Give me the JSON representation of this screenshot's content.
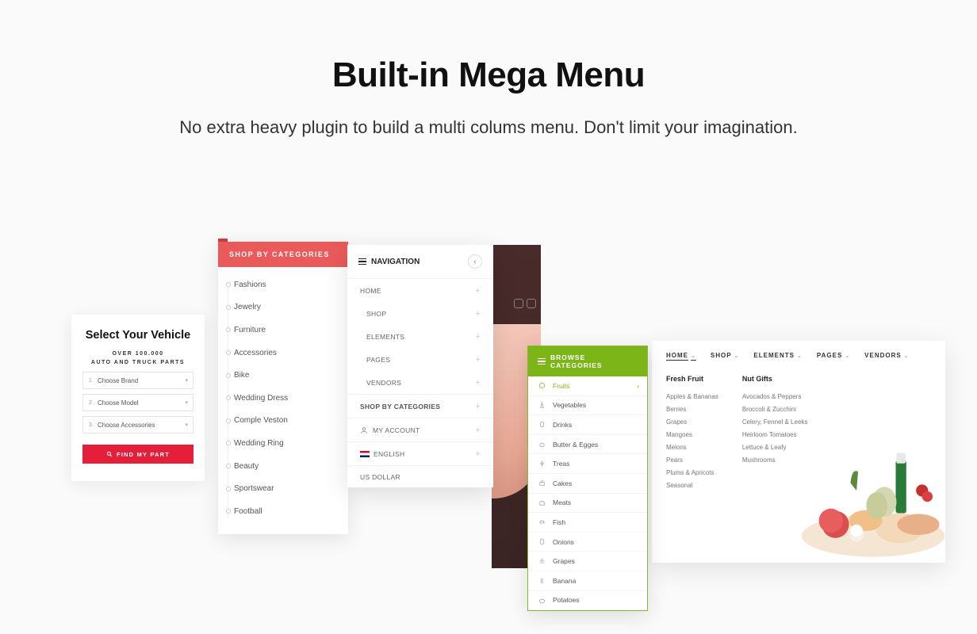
{
  "hero": {
    "title": "Built-in Mega Menu",
    "subtitle": "No extra heavy plugin to build a multi colums menu. Don't limit your imagination."
  },
  "vehicle": {
    "title": "Select Your Vehicle",
    "sub1": "OVER 100.000",
    "sub2": "AUTO AND TRUCK PARTS",
    "steps": [
      {
        "n": "1",
        "label": "Choose Brand"
      },
      {
        "n": "2",
        "label": "Choose Model"
      },
      {
        "n": "3",
        "label": "Choose Accessories"
      }
    ],
    "button": "FIND MY PART"
  },
  "categories": {
    "header": "SHOP BY CATEGORIES",
    "items": [
      "Fashions",
      "Jewelry",
      "Furniture",
      "Accessories",
      "Bike",
      "Wedding Dress",
      "Comple Veston",
      "Wedding Ring",
      "Beauty",
      "Sportswear",
      "Football"
    ]
  },
  "navigation": {
    "title": "NAVIGATION",
    "items": [
      "HOME",
      "SHOP",
      "ELEMENTS",
      "PAGES",
      "VENDORS"
    ],
    "shop_by": "SHOP BY CATEGORIES",
    "account": "MY ACCOUNT",
    "lang": "ENGLISH",
    "currency": "US DOLLAR"
  },
  "browse": {
    "header": "BROWSE CATEGORIES",
    "items": [
      "Fruits",
      "Vegetables",
      "Drinks",
      "Butter & Egges",
      "Treas",
      "Cakes",
      "Meats",
      "Fish",
      "Onions",
      "Grapes",
      "Banana",
      "Potatoes"
    ]
  },
  "mega": {
    "nav": [
      "HOME",
      "SHOP",
      "ELEMENTS",
      "PAGES",
      "VENDORS"
    ],
    "col1": {
      "title": "Fresh Fruit",
      "items": [
        "Apples & Bananas",
        "Berries",
        "Grapes",
        "Mangoes",
        "Melons",
        "Pears",
        "Plums & Apricots",
        "Seasonal"
      ]
    },
    "col2": {
      "title": "Nut Gifts",
      "items": [
        "Avocados & Peppers",
        "Broccoli & Zucchini",
        "Celery, Fennel & Leeks",
        "Heirloom Tomatoes",
        "Lettuce & Leafy",
        "Mushrooms"
      ]
    }
  }
}
